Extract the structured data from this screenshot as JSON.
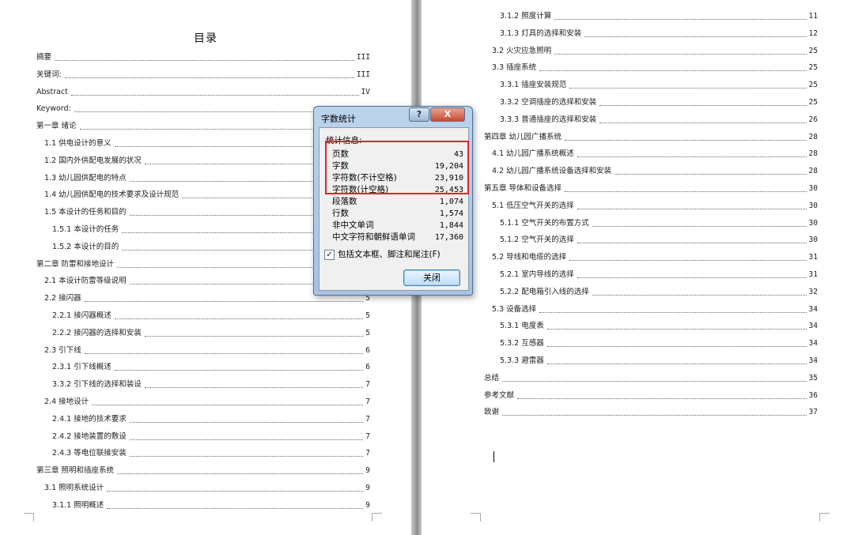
{
  "left_page": {
    "title": "目录",
    "entries": [
      {
        "text": "摘要",
        "page": "III"
      },
      {
        "text": "关键词:",
        "page": "III"
      },
      {
        "text": "Abstract",
        "page": "IV"
      },
      {
        "text": "Keyword:",
        "page": ""
      },
      {
        "text": "第一章  绪论",
        "page": ""
      },
      {
        "text": "1.1 供电设计的意义",
        "page": ""
      },
      {
        "text": "1.2 国内外供配电发展的状况",
        "page": ""
      },
      {
        "text": "1.3 幼儿园供配电的特点",
        "page": ""
      },
      {
        "text": "1.4 幼儿园供配电的技术要求及设计规范",
        "page": ""
      },
      {
        "text": "1.5 本设计的任务和目的",
        "page": ""
      },
      {
        "text": "1.5.1 本设计的任务",
        "page": ""
      },
      {
        "text": "1.5.2 本设计的目的",
        "page": ""
      },
      {
        "text": "第二章  防雷和接地设计",
        "page": ""
      },
      {
        "text": "2.1 本设计防雷等级说明",
        "page": ""
      },
      {
        "text": "2.2 接闪器",
        "page": "5"
      },
      {
        "text": "2.2.1 接闪器概述",
        "page": "5"
      },
      {
        "text": "2.2.2 接闪器的选择和安装",
        "page": "5"
      },
      {
        "text": "2.3 引下线",
        "page": "6"
      },
      {
        "text": "2.3.1 引下线概述",
        "page": "6"
      },
      {
        "text": "3.3.2 引下线的选择和装设",
        "page": "7"
      },
      {
        "text": "2.4 接地设计",
        "page": "7"
      },
      {
        "text": "2.4.1 接地的技术要求",
        "page": "7"
      },
      {
        "text": "2.4.2 接地装置的敷设",
        "page": "7"
      },
      {
        "text": "2.4.3 等电位联接安装",
        "page": "7"
      },
      {
        "text": "第三章  照明和插座系统",
        "page": "9"
      },
      {
        "text": "3.1 照明系统设计",
        "page": "9"
      },
      {
        "text": "3.1.1 照明概述",
        "page": "9"
      }
    ]
  },
  "right_page": {
    "entries": [
      {
        "text": "3.1.2 照度计算",
        "page": "11"
      },
      {
        "text": "3.1.3 灯具的选择和安装",
        "page": "12"
      },
      {
        "text": "3.2 火灾应急照明",
        "page": "25"
      },
      {
        "text": "3.3 插座系统",
        "page": "25"
      },
      {
        "text": "3.3.1 插座安装规范",
        "page": "25"
      },
      {
        "text": "3.3.2 空调插座的选择和安装",
        "page": "25"
      },
      {
        "text": "3.3.3 普通插座的选择和安装",
        "page": "26"
      },
      {
        "text": "第四章  幼儿园广播系统",
        "page": "28"
      },
      {
        "text": "4.1 幼儿园广播系统概述",
        "page": "28"
      },
      {
        "text": "4.2 幼儿园广播系统设备选择和安装",
        "page": "28"
      },
      {
        "text": "第五章  导体和设备选择",
        "page": "30"
      },
      {
        "text": "5.1 低压空气开关的选择",
        "page": "30"
      },
      {
        "text": "5.1.1 空气开关的布置方式",
        "page": "30"
      },
      {
        "text": "5.1.2 空气开关的选择",
        "page": "30"
      },
      {
        "text": "5.2 导线和电缆的选择",
        "page": "31"
      },
      {
        "text": "5.2.1 室内导线的选择",
        "page": "31"
      },
      {
        "text": "5.2.2 配电箱引入线的选择",
        "page": "32"
      },
      {
        "text": "5.3 设备选择",
        "page": "34"
      },
      {
        "text": "5.3.1 电度表",
        "page": "34"
      },
      {
        "text": "5.3.2 互感器",
        "page": "34"
      },
      {
        "text": "5.3.3 避雷器",
        "page": "34"
      },
      {
        "text": "总结",
        "page": "35"
      },
      {
        "text": "参考文献",
        "page": "36"
      },
      {
        "text": "致谢",
        "page": "37"
      }
    ]
  },
  "dialog": {
    "title": "字数统计",
    "help_label": "?",
    "close_label": "X",
    "group_label": "统计信息:",
    "stats": [
      {
        "label": "页数",
        "value": "43"
      },
      {
        "label": "字数",
        "value": "19,204"
      },
      {
        "label": "字符数(不计空格)",
        "value": "23,910"
      },
      {
        "label": "字符数(计空格)",
        "value": "25,453"
      },
      {
        "label": "段落数",
        "value": "1,074"
      },
      {
        "label": "行数",
        "value": "1,574"
      },
      {
        "label": "非中文单词",
        "value": "1,844"
      },
      {
        "label": "中文字符和朝鲜语单词",
        "value": "17,360"
      }
    ],
    "checkbox_label": "包括文本框、脚注和尾注(F)",
    "checkbox_checked": true,
    "checkbox_mark": "✓",
    "close_button_label": "关闭"
  },
  "colors": {
    "highlight_box": "#e0242a",
    "dialog_frame": "#a7c2e2",
    "gutter": "#9a9a9a"
  }
}
